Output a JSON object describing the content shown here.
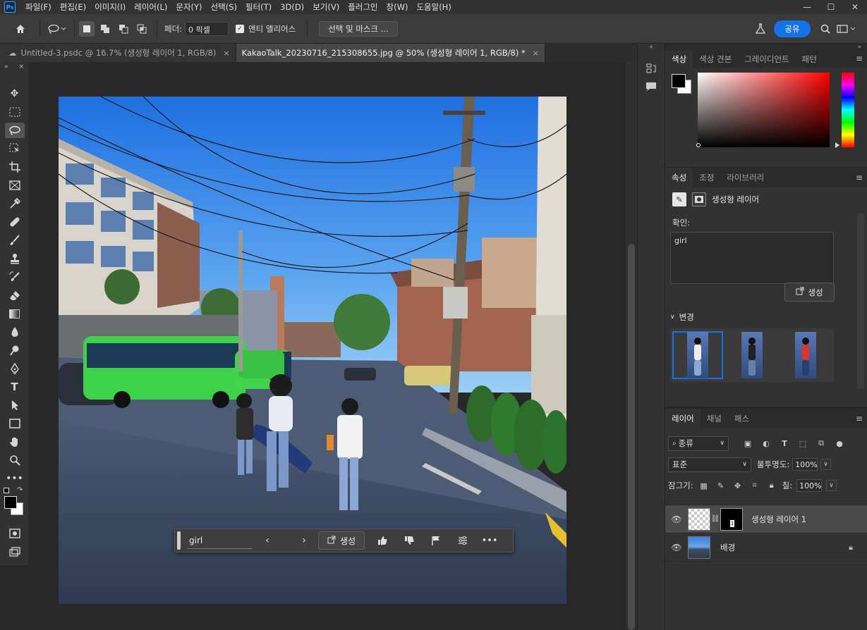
{
  "app": {
    "logo": "Ps"
  },
  "menu": [
    "파일(F)",
    "편집(E)",
    "이미지(I)",
    "레이어(L)",
    "문자(Y)",
    "선택(S)",
    "필터(T)",
    "3D(D)",
    "보기(V)",
    "플러그인",
    "창(W)",
    "도움말(H)"
  ],
  "window_controls": {
    "minimize": "—",
    "maximize": "☐",
    "close": "✕"
  },
  "options": {
    "feather_label": "페더:",
    "feather_value": "0 픽셀",
    "antialias_label": "앤티 앨리어스",
    "antialias_checked": "✓",
    "select_mask_button": "선택 및 마스크 ...",
    "share_button": "공유"
  },
  "tabs": [
    {
      "label": "Untitled-3.psdc @ 16.7% (생성형 레이어 1, RGB/8)",
      "close": "×",
      "active": false
    },
    {
      "label": "KakaoTalk_20230716_215308655.jpg @ 50% (생성형 레이어 1, RGB/8) *",
      "close": "×",
      "active": true
    }
  ],
  "toolbar": {
    "expand": "»",
    "close": "×"
  },
  "context_bar": {
    "prompt_value": "girl",
    "prev": "‹",
    "next": "›",
    "generate_label": "생성"
  },
  "color_panel": {
    "tabs": [
      "색상",
      "색상 견본",
      "그레이디언트",
      "패턴"
    ],
    "fg_color": "#000000",
    "bg_color": "#ffffff"
  },
  "properties_panel": {
    "tabs": [
      "속성",
      "조정",
      "라이브러리"
    ],
    "layer_type": "생성형 레이어",
    "prompt_label": "확인:",
    "prompt_value": "girl",
    "generate_button": "생성",
    "variations_label": "변경"
  },
  "layers_panel": {
    "tabs": [
      "레이어",
      "채널",
      "패스"
    ],
    "filter_value": "종류",
    "blend_mode": "표준",
    "opacity_label": "불투명도:",
    "opacity_value": "100%",
    "lock_label": "잠그기:",
    "fill_label": "칠:",
    "fill_value": "100%",
    "layers": [
      {
        "name": "생성형 레이어 1",
        "selected": true,
        "mask_number": "1"
      },
      {
        "name": "배경",
        "selected": false
      }
    ]
  },
  "colors": {
    "accent": "#1473e6",
    "panel_bg": "#323232"
  }
}
